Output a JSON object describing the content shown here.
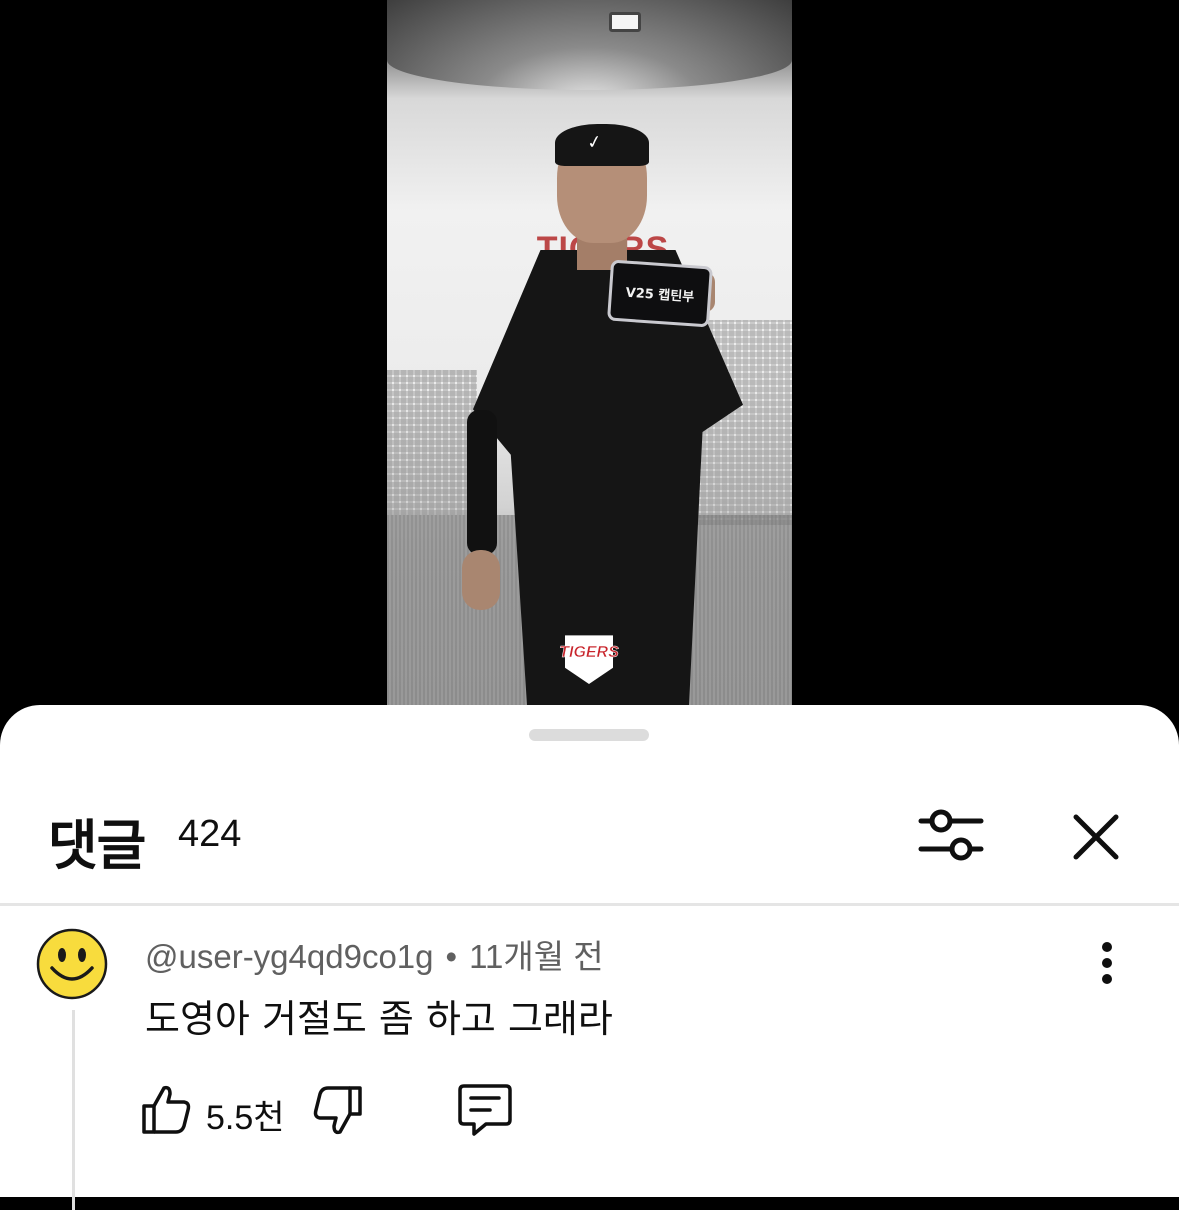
{
  "video": {
    "phone_screen_text": "V25 캡틴부",
    "wall_logo_text": "TIGERS",
    "badge_text": "TIGERS"
  },
  "comments_sheet": {
    "title": "댓글",
    "count": "424"
  },
  "comment": {
    "author": "@user-yg4qd9co1g",
    "separator": "•",
    "time": "11개월 전",
    "text": "도영아 거절도 좀 하고 그래라",
    "like_count": "5.5천"
  },
  "colors": {
    "sheet_background": "#ffffff",
    "video_letterbox": "#000000",
    "text_primary": "#0f0f0f",
    "text_secondary": "#606060",
    "brand_red": "#c8242b",
    "avatar_yellow": "#f8dc3d"
  },
  "icons": {
    "filter": "sliders-icon",
    "close": "close-icon",
    "more": "vertical-dots-icon",
    "like": "thumbs-up-icon",
    "dislike": "thumbs-down-icon",
    "reply": "comment-bubble-icon",
    "avatar": "smiley-face-icon"
  }
}
